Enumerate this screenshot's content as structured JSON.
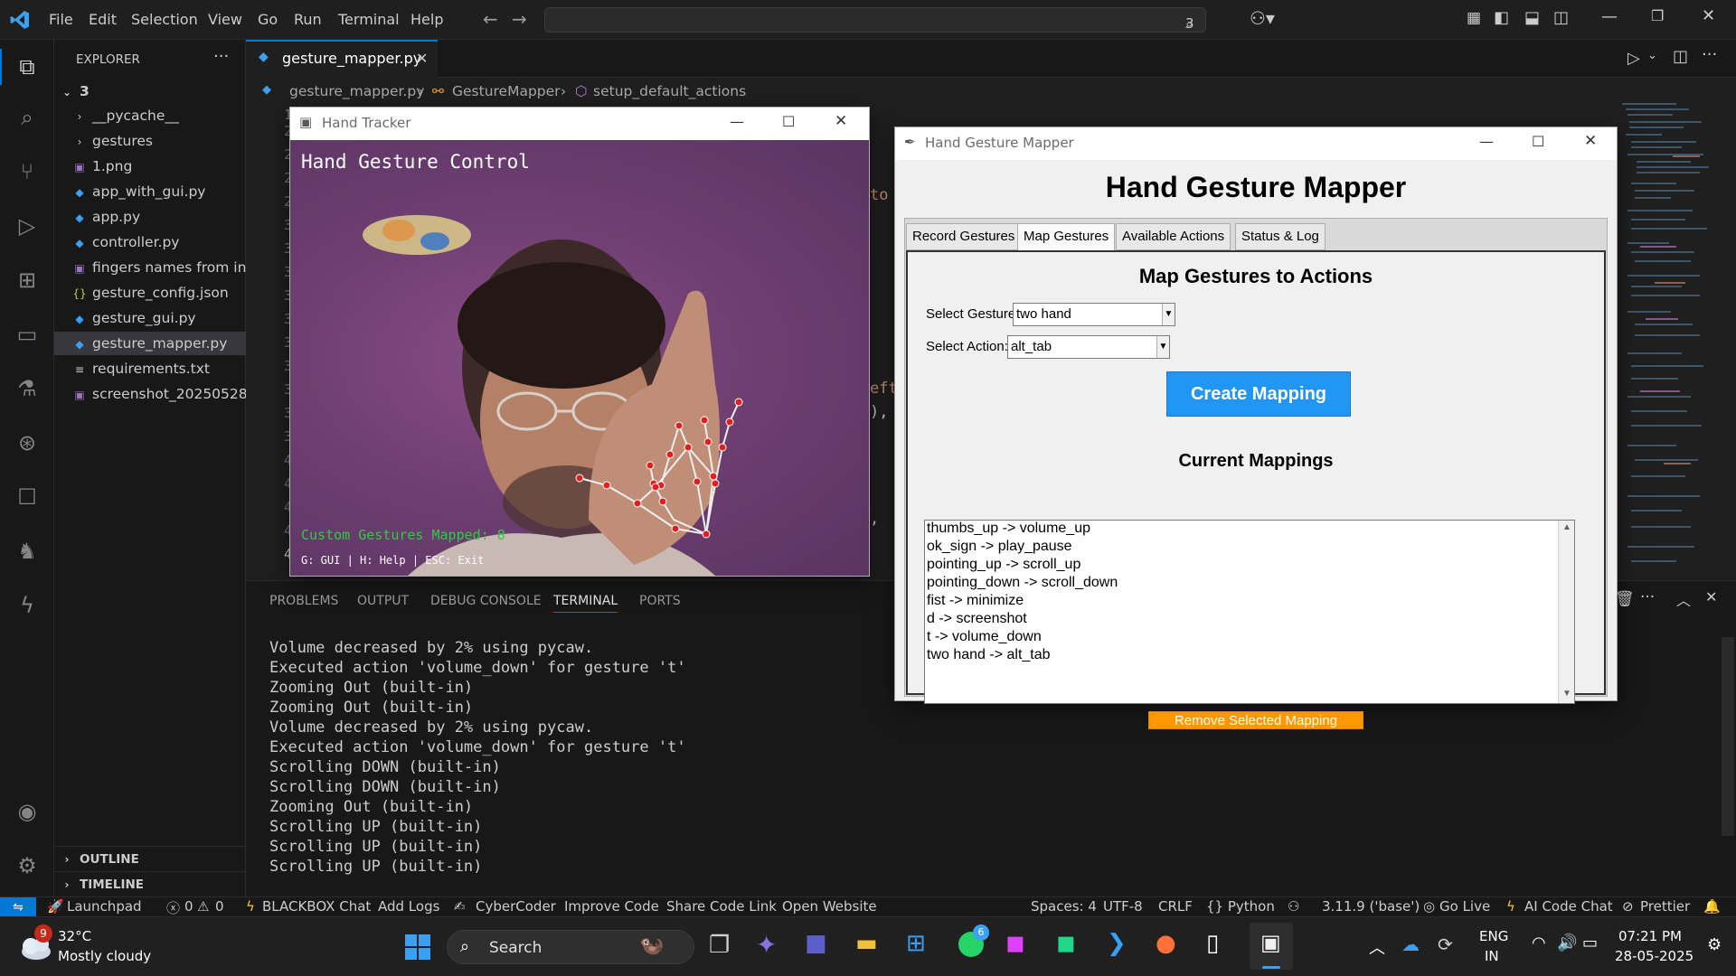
{
  "titlebar": {
    "menus": [
      "File",
      "Edit",
      "Selection",
      "View",
      "Go",
      "Run",
      "Terminal",
      "Help"
    ],
    "search_text": "3"
  },
  "sidebar": {
    "title": "EXPLORER",
    "root": "3",
    "items": [
      {
        "label": "__pycache__",
        "kind": "folder"
      },
      {
        "label": "gestures",
        "kind": "folder"
      },
      {
        "label": "1.png",
        "kind": "image"
      },
      {
        "label": "app_with_gui.py",
        "kind": "python"
      },
      {
        "label": "app.py",
        "kind": "python"
      },
      {
        "label": "controller.py",
        "kind": "python"
      },
      {
        "label": "fingers names from in...",
        "kind": "image"
      },
      {
        "label": "gesture_config.json",
        "kind": "json"
      },
      {
        "label": "gesture_gui.py",
        "kind": "python"
      },
      {
        "label": "gesture_mapper.py",
        "kind": "python",
        "selected": true
      },
      {
        "label": "requirements.txt",
        "kind": "text"
      },
      {
        "label": "screenshot_20250528...",
        "kind": "image"
      }
    ],
    "outline": "OUTLINE",
    "timeline": "TIMELINE"
  },
  "editor": {
    "tab": "gesture_mapper.py",
    "breadcrumb": [
      "gesture_mapper.py",
      "GestureMapper",
      "setup_default_actions"
    ],
    "line_numbers": [
      "16",
      "26",
      "27",
      "28",
      "29",
      "30",
      "31",
      "32",
      "33",
      "34",
      "35",
      "36",
      "37",
      "38",
      "39",
      "40",
      "41",
      "42",
      "43",
      "44",
      "45",
      "46"
    ],
    "code_fragments": [
      "to g",
      "eft",
      "),",
      ","
    ]
  },
  "panel": {
    "tabs": [
      "PROBLEMS",
      "OUTPUT",
      "DEBUG CONSOLE",
      "TERMINAL",
      "PORTS"
    ],
    "active_tab": "TERMINAL",
    "lines": [
      "Volume decreased by 2% using pycaw.",
      "Executed action 'volume_down' for gesture 't'",
      "Zooming Out (built-in)",
      "Zooming Out (built-in)",
      "Volume decreased by 2% using pycaw.",
      "Executed action 'volume_down' for gesture 't'",
      "Scrolling DOWN (built-in)",
      "Scrolling DOWN (built-in)",
      "Zooming Out (built-in)",
      "Scrolling UP (built-in)",
      "Scrolling UP (built-in)",
      "Scrolling UP (built-in)"
    ]
  },
  "tracker": {
    "title": "Hand Tracker",
    "overlay_title": "Hand Gesture Control",
    "overlay_status": "Custom Gestures Mapped: 8",
    "overlay_help": "G: GUI | H: Help | ESC: Exit"
  },
  "mapper": {
    "title": "Hand Gesture Mapper",
    "heading": "Hand Gesture Mapper",
    "tabs": [
      "Record Gestures",
      "Map Gestures",
      "Available Actions",
      "Status & Log"
    ],
    "active_tab": "Map Gestures",
    "section_title": "Map Gestures to Actions",
    "select_gesture_label": "Select Gesture:",
    "select_gesture_value": "two hand",
    "select_action_label": "Select Action:",
    "select_action_value": "alt_tab",
    "create_button": "Create Mapping",
    "current_title": "Current Mappings",
    "mappings": [
      "thumbs_up -> volume_up",
      "ok_sign -> play_pause",
      "pointing_up -> scroll_up",
      "pointing_down -> scroll_down",
      "fist -> minimize",
      "d -> screenshot",
      "t -> volume_down",
      "two hand -> alt_tab"
    ],
    "remove_button": "Remove Selected Mapping",
    "colors": {
      "create": "#2196f3",
      "remove": "#ff9800"
    }
  },
  "statusbar": {
    "left": [
      "Launchpad",
      "0",
      "0",
      "BLACKBOX Chat",
      "Add Logs",
      "CyberCoder",
      "Improve Code",
      "Share Code Link",
      "Open Website"
    ],
    "right": [
      "Spaces: 4",
      "UTF-8",
      "CRLF",
      "{} Python",
      "3.11.9 ('base')",
      "Go Live",
      "AI Code Chat",
      "Prettier"
    ]
  },
  "taskbar": {
    "weather_temp": "32°C",
    "weather_desc": "Mostly cloudy",
    "weather_badge": "9",
    "search": "Search",
    "whatsapp_badge": "6",
    "lang1": "ENG",
    "lang2": "IN",
    "time": "07:21 PM",
    "date": "28-05-2025"
  },
  "colors": {
    "accent": "#0078d4",
    "statusbar_remote": "#0078d4"
  }
}
